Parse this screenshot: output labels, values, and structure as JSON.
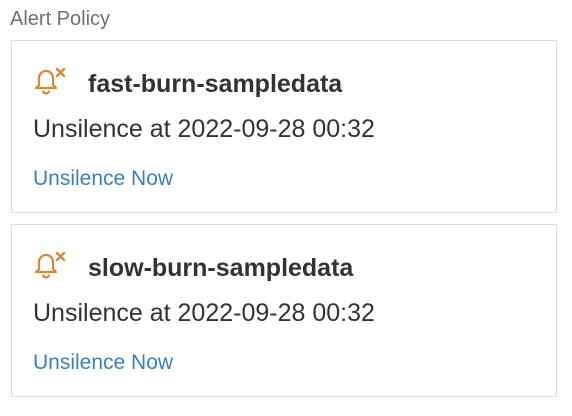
{
  "section": {
    "title": "Alert Policy"
  },
  "colors": {
    "bell": "#d08a3a",
    "link": "#3a82b5",
    "border": "#d9d9d9"
  },
  "policies": [
    {
      "name": "fast-burn-sampledata",
      "icon": "bell-off-icon",
      "silence_text": "Unsilence at 2022-09-28 00:32",
      "action_label": "Unsilence Now"
    },
    {
      "name": "slow-burn-sampledata",
      "icon": "bell-off-icon",
      "silence_text": "Unsilence at 2022-09-28 00:32",
      "action_label": "Unsilence Now"
    }
  ]
}
